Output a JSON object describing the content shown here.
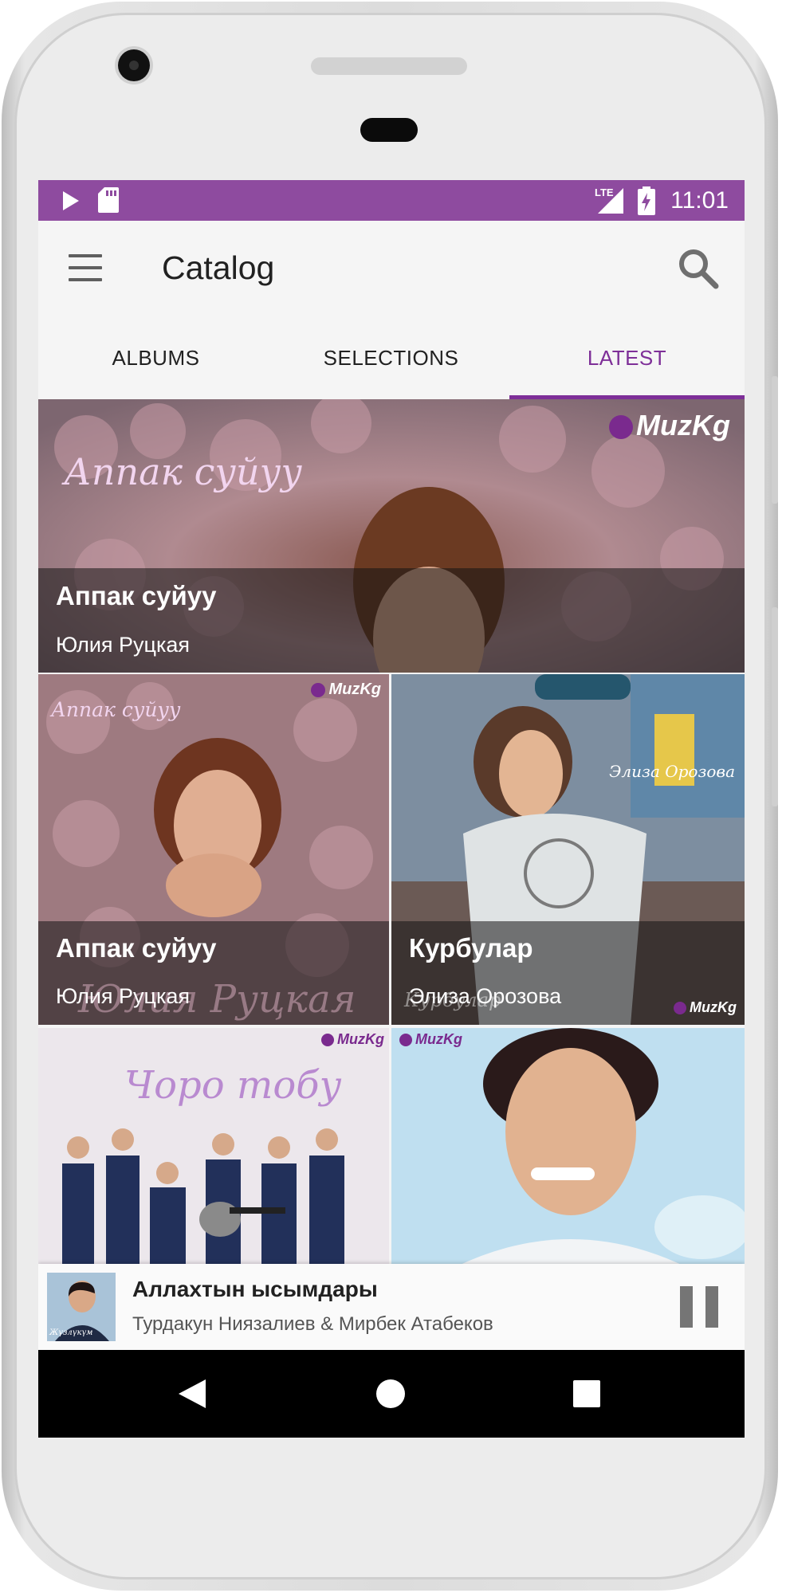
{
  "status_bar": {
    "time": "11:01",
    "network": "LTE",
    "background_color": "#8e4b9f",
    "left_icons": [
      "play-icon",
      "sd-card-icon"
    ],
    "right_icons": [
      "lte-signal-icon",
      "battery-charging-icon"
    ]
  },
  "app_bar": {
    "title": "Catalog",
    "menu_icon": "hamburger-menu-icon",
    "search_icon": "search-icon"
  },
  "tabs": [
    {
      "label": "ALBUMS",
      "active": false
    },
    {
      "label": "SELECTIONS",
      "active": false
    },
    {
      "label": "LATEST",
      "active": true
    }
  ],
  "accent_color": "#7e2f98",
  "grid": {
    "featured": {
      "title": "Аппак суйуу",
      "artist": "Юлия Руцкая",
      "cover_text": "Аппак суйуу",
      "watermark": "MuzKg"
    },
    "cards": [
      {
        "title": "Аппак суйуу",
        "artist": "Юлия Руцкая",
        "cover_text": "Аппак суйуу",
        "cover_text_bottom": "Юлия Руцкая",
        "watermark": "MuzKg"
      },
      {
        "title": "Курбулар",
        "artist": "Элиза Орозова",
        "cover_text": "Элиза Орозова",
        "cover_text_bottom": "Курбулар",
        "watermark": "MuzKg"
      },
      {
        "title": "",
        "artist": "",
        "cover_text": "Чоро тобу",
        "watermark": "MuzKg"
      },
      {
        "title": "",
        "artist": "",
        "cover_text": "",
        "watermark": "MuzKg"
      }
    ]
  },
  "mini_player": {
    "title": "Аллахтын ысымдары",
    "artist": "Турдакун Ниязалиев & Мирбек Атабеков",
    "thumb_text": "Жүзлүкүм",
    "control": "pause-icon"
  },
  "nav_bar": {
    "buttons": [
      "back-icon",
      "home-icon",
      "recents-icon"
    ]
  }
}
